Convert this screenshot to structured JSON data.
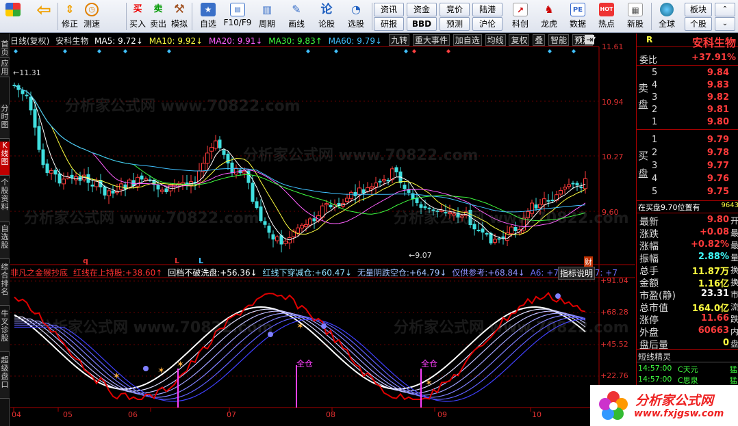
{
  "toolbar": {
    "buttons": [
      {
        "label": "",
        "icon": "windows-icon"
      },
      {
        "label": "",
        "icon": "back-arrow-icon"
      },
      {
        "label": "修正",
        "icon": "up-down-arrow-icon"
      },
      {
        "label": "测速",
        "icon": "speed-clock-icon"
      },
      {
        "label": "买入",
        "icon": "buy-icon",
        "glyph": "买"
      },
      {
        "label": "卖出",
        "icon": "sell-icon",
        "glyph": "卖"
      },
      {
        "label": "模拟",
        "icon": "hammer-icon"
      },
      {
        "label": "自选",
        "icon": "star-folder-icon"
      },
      {
        "label": "F10/F9",
        "icon": "f10-icon"
      },
      {
        "label": "周期",
        "icon": "period-icon"
      },
      {
        "label": "画线",
        "icon": "pencil-icon"
      },
      {
        "label": "论股",
        "icon": "discuss-icon",
        "glyph": "论"
      },
      {
        "label": "选股",
        "icon": "select-stock-icon"
      },
      {
        "label": "科创",
        "icon": "chart-up-icon"
      },
      {
        "label": "龙虎",
        "icon": "dragon-icon"
      },
      {
        "label": "数据",
        "icon": "pe-icon",
        "glyph": "PE"
      },
      {
        "label": "热点",
        "icon": "hot-icon",
        "glyph": "HOT"
      },
      {
        "label": "新股",
        "icon": "calendar-icon"
      },
      {
        "label": "全球",
        "icon": "globe-icon"
      }
    ],
    "small_buttons": [
      "资讯",
      "资金",
      "竞价",
      "陆港",
      "研报",
      "BBD",
      "预测",
      "沪伦",
      "板块",
      "个股"
    ]
  },
  "left_tabs": [
    "首页",
    "应用",
    "分时图",
    "K线图",
    "个股资料",
    "自选股",
    "综合排名",
    "牛叉诊股",
    "超级盘口"
  ],
  "chart": {
    "info": {
      "period": "日线(复权)",
      "stock": "安科生物",
      "ma5": "MA5: 9.72↓",
      "ma10": "MA10: 9.92↓",
      "ma20": "MA20: 9.91↓",
      "ma30": "MA30: 9.83↑",
      "ma60": "MA60: 9.79↓"
    },
    "buttons": [
      "九转",
      "重大事件",
      "加自选",
      "均线",
      "复权",
      "叠",
      "智能",
      "预测"
    ],
    "price_axis": [
      "11.61",
      "10.94",
      "10.27",
      "9.60"
    ],
    "high_label": "11.31",
    "low_label": "9.07",
    "markers": [
      "q",
      "L",
      "L",
      "财"
    ],
    "indicator": {
      "name": "非凡之金猴抄底",
      "l1": "红线在上持股:",
      "v1": "+38.60↑",
      "l2": "回档不破洗盘:",
      "v2": "+56.36↓",
      "l3": "红线下穿减仓:",
      "v3": "+60.47↓",
      "l4": "无量阴跌空仓:",
      "v4": "+64.79↓",
      "l5": "仅供参考:",
      "v5": "+68.84↓",
      "a6": "A6: +72.30↓",
      "a7": "A7: +7",
      "help": "指标说明",
      "axis": [
        "+91.04",
        "+68.28",
        "+45.52",
        "+22.76"
      ],
      "signals": [
        "全仓",
        "全仓"
      ]
    },
    "x_axis": [
      "04",
      "05",
      "06",
      "07",
      "08",
      "09",
      "10"
    ],
    "watermark": "分析家公式网 www.70822.com"
  },
  "panel": {
    "title": "安科生物",
    "r_label": "R",
    "weibi_label": "委比",
    "weibi_value": "+37.91%",
    "sell_label": "卖盘",
    "buy_label": "买盘",
    "sell": [
      {
        "lvl": "5",
        "price": "9.84"
      },
      {
        "lvl": "4",
        "price": "9.83"
      },
      {
        "lvl": "3",
        "price": "9.82"
      },
      {
        "lvl": "2",
        "price": "9.81"
      },
      {
        "lvl": "1",
        "price": "9.80"
      }
    ],
    "buy": [
      {
        "lvl": "1",
        "price": "9.79"
      },
      {
        "lvl": "2",
        "price": "9.78"
      },
      {
        "lvl": "3",
        "price": "9.77"
      },
      {
        "lvl": "4",
        "price": "9.76"
      },
      {
        "lvl": "5",
        "price": "9.75"
      }
    ],
    "queue": "在买盘9.70位置有",
    "queue_num": "9643",
    "stats": [
      {
        "label": "最新",
        "value": "9.80",
        "cls": "red",
        "extra": "开"
      },
      {
        "label": "涨跌",
        "value": "+0.08",
        "cls": "red",
        "extra": "最"
      },
      {
        "label": "涨幅",
        "value": "+0.82%",
        "cls": "red",
        "extra": "最"
      },
      {
        "label": "振幅",
        "value": "2.88%",
        "cls": "cyan",
        "extra": "量"
      },
      {
        "label": "总手",
        "value": "11.87万",
        "cls": "yel",
        "extra": "换"
      },
      {
        "label": "金额",
        "value": "1.16亿",
        "cls": "yel",
        "extra": "换"
      },
      {
        "label": "市盈(静)",
        "value": "23.31",
        "cls": "wht",
        "extra": "市"
      },
      {
        "label": "总市值",
        "value": "164.0亿",
        "cls": "yel",
        "extra": "流"
      },
      {
        "label": "涨停",
        "value": "11.66",
        "cls": "red",
        "extra": "跌"
      },
      {
        "label": "外盘",
        "value": "60663",
        "cls": "red",
        "extra": "内"
      },
      {
        "label": "盘后量",
        "value": "0",
        "cls": "yel",
        "extra": "盘"
      }
    ],
    "elf_title": "短线精灵",
    "elf": [
      {
        "time": "14:57:00",
        "name": "C天元",
        "act": "猛"
      },
      {
        "time": "14:57:00",
        "name": "C思泉",
        "act": "猛"
      }
    ],
    "logo_text": "分析家公式网",
    "logo_url": "www.fxjgsw.com"
  }
}
